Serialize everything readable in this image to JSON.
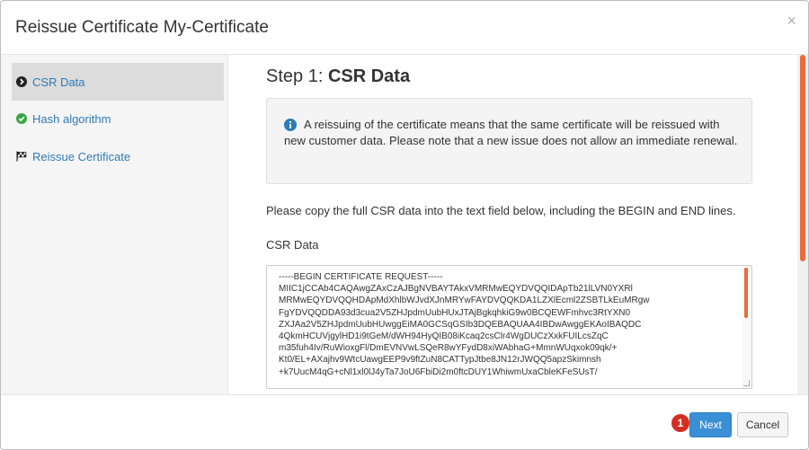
{
  "modal": {
    "title": "Reissue Certificate My-Certificate",
    "close_label": "×"
  },
  "sidebar": {
    "items": [
      {
        "label": "CSR Data",
        "icon": "chevron-right-circle-icon",
        "active": true
      },
      {
        "label": "Hash algorithm",
        "icon": "check-circle-icon",
        "active": false
      },
      {
        "label": "Reissue Certificate",
        "icon": "flag-checkered-icon",
        "active": false
      }
    ]
  },
  "main": {
    "step_prefix": "Step 1:",
    "step_title": "CSR Data",
    "info_text": "A reissuing of the certificate means that the same certificate will be reissued with new customer data. Please note that a new issue does not allow an immediate renewal.",
    "instruction": "Please copy the full CSR data into the text field below, including the BEGIN and END lines.",
    "csr_label": "CSR Data",
    "csr_value": "-----BEGIN CERTIFICATE REQUEST-----\nMIIC1jCCAb4CAQAwgZAxCzAJBgNVBAYTAkxVMRMwEQYDVQQIDApTb21lLVN0YXRl\nMRMwEQYDVQQHDApMdXhlbWJvdXJnMRYwFAYDVQQKDA1LZXlEcml2ZSBTLkEuMRgw\nFgYDVQQDDA93d3cua2V5ZHJpdmUubHUxJTAjBgkqhkiG9w0BCQEWFmhvc3RtYXN0\nZXJAa2V5ZHJpdmUubHUwggEiMA0GCSqGSIb3DQEBAQUAA4IBDwAwggEKAoIBAQDC\n4QkmHCUVjgylHD1i9tGeM/dWH94HyQIB08iKcaq2csClr4WgDUCzXxkFUILcsZqC\nm35fuh4Iv/RuWioxgFl/DmEVNVwLSQeR8wYFydD8xiWAbhaG+MmnWUqxok09qk/+\nKt0/EL+AXajhv9WtcUawgEEP9v9ftZuN8CATTypJtbe8JN12rJWQQ5apzSkimnsh\n+k7UucM4qG+cNl1xl0lJ4yTa7JoU6FbiDi2m0ftcDUY1WhiwmUxaCbleKFeSUsT/"
  },
  "footer": {
    "badge": "1",
    "next_label": "Next",
    "cancel_label": "Cancel"
  }
}
